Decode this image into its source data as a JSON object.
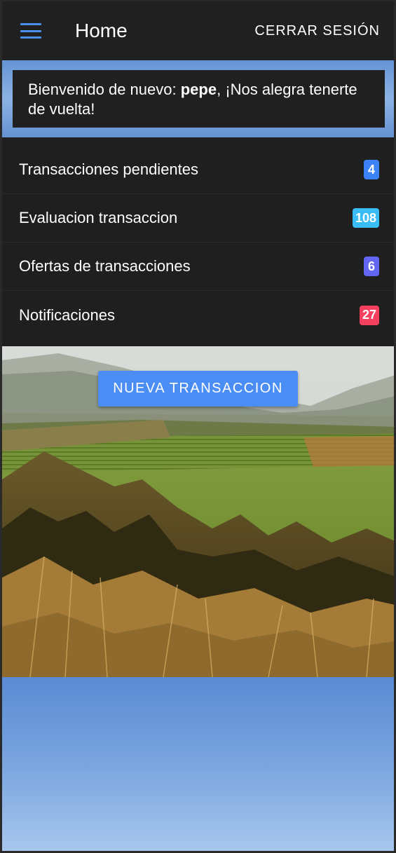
{
  "toolbar": {
    "menu_icon": "hamburger-menu-icon",
    "title": "Home",
    "logout_label": "CERRAR SESIÓN"
  },
  "welcome": {
    "prefix": "Bienvenido de nuevo: ",
    "username": "pepe",
    "suffix": ", ¡Nos alegra tenerte de vuelta!"
  },
  "menu_items": [
    {
      "label": "Transacciones pendientes",
      "count": "4",
      "badge_color": "#3b82f6"
    },
    {
      "label": "Evaluacion transaccion",
      "count": "108",
      "badge_color": "#38bdf8"
    },
    {
      "label": "Ofertas de transacciones",
      "count": "6",
      "badge_color": "#6366f1"
    },
    {
      "label": "Notificaciones",
      "count": "27",
      "badge_color": "#f43f5e"
    }
  ],
  "actions": {
    "new_transaction_label": "NUEVA TRANSACCION"
  },
  "colors": {
    "accent": "#4a8ef5",
    "toolbar_bg": "#202020",
    "list_bg": "#1f1f1f"
  }
}
